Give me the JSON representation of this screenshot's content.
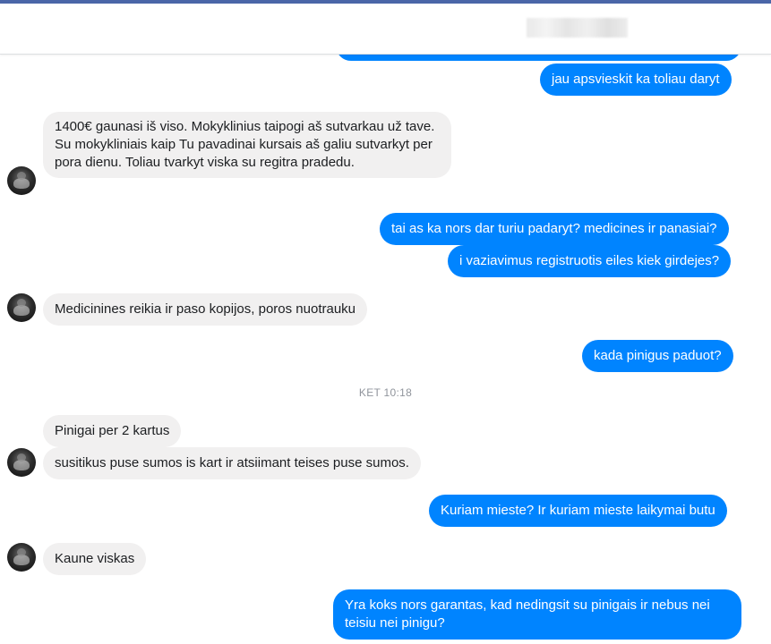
{
  "header": {
    "contact_name": ""
  },
  "messages": {
    "m0": "",
    "m1": "jau apsvieskit ka toliau daryt",
    "m2": "1400€ gaunasi iš viso. Mokyklinius taipogi aš sutvarkau už tave. Su mokykliniais kaip Tu pavadinai kursais aš galiu sutvarkyt per pora dienu. Toliau tvarkyt viska su regitra pradedu.",
    "m3": "tai as ka nors dar turiu padaryt? medicines ir panasiai?",
    "m4": "i vaziavimus registruotis eiles kiek girdejes?",
    "m5": "Medicinines reikia ir paso kopijos, poros nuotrauku",
    "m6": "kada pinigus paduot?",
    "m7": "Pinigai per 2 kartus",
    "m8": "susitikus puse sumos is kart ir atsiimant teises puse sumos.",
    "m9": "Kuriam mieste? Ir kuriam mieste laikymai butu",
    "m10": "Kaune viskas",
    "m11": "Yra koks nors garantas, kad nedingsit su pinigais ir nebus nei teisiu nei pinigu?"
  },
  "timestamp": "KET 10:18",
  "colors": {
    "outgoing": "#0084ff",
    "incoming": "#f1f0f0",
    "header_bar": "#4a66a8"
  }
}
